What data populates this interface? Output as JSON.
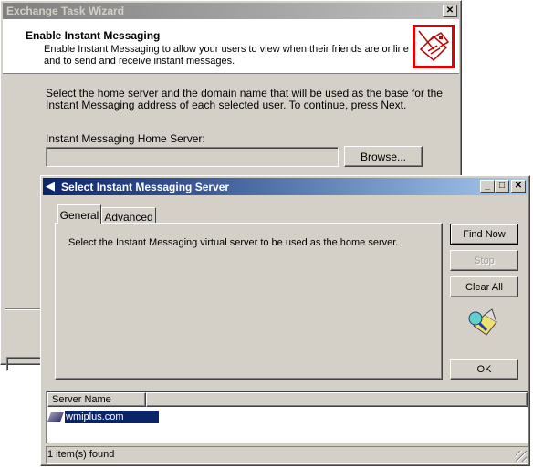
{
  "wizard": {
    "title": "Exchange Task Wizard",
    "header_title": "Enable Instant Messaging",
    "header_desc_1": "Enable Instant Messaging to allow your users to view when their friends are online",
    "header_desc_2": "and to send and receive instant messages.",
    "instructions_1": "Select the home server and the domain name that will be used as the base for the",
    "instructions_2": "Instant Messaging address of each selected user. To continue, press Next.",
    "home_server_label": "Instant Messaging Home Server:",
    "home_server_value": "",
    "browse_label": "Browse..."
  },
  "dialog": {
    "title": "Select Instant Messaging Server",
    "tabs": [
      {
        "label": "General"
      },
      {
        "label": "Advanced"
      }
    ],
    "general_text": "Select the Instant Messaging virtual server to be used as the home server.",
    "find_now": "Find Now",
    "stop": "Stop",
    "clear_all": "Clear All",
    "ok": "OK",
    "list_header": "Server Name",
    "rows": [
      {
        "name": "wmiplus.com"
      }
    ],
    "status": "1 item(s) found"
  },
  "colors": {
    "accent": "#0a246a",
    "selection": "#0a246a",
    "header_icon_border": "#e00000"
  }
}
